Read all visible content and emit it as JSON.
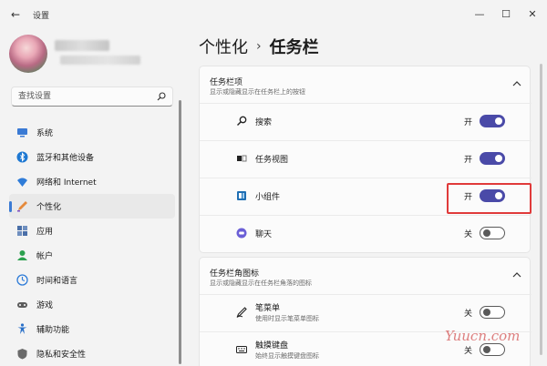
{
  "window": {
    "title": "设置",
    "back_glyph": "←",
    "min_glyph": "—",
    "max_glyph": "☐",
    "close_glyph": "✕"
  },
  "search": {
    "placeholder": "查找设置"
  },
  "sidebar": {
    "active_index": 3,
    "items": [
      {
        "label": "系统",
        "icon": "system-icon",
        "color": "#3a7ad4"
      },
      {
        "label": "蓝牙和其他设备",
        "icon": "bluetooth-icon",
        "color": "#1e78d2"
      },
      {
        "label": "网络和 Internet",
        "icon": "network-icon",
        "color": "#2f7cd8"
      },
      {
        "label": "个性化",
        "icon": "personalization-icon",
        "color": "#e58a3c"
      },
      {
        "label": "应用",
        "icon": "apps-icon",
        "color": "#4a6fa8"
      },
      {
        "label": "帐户",
        "icon": "accounts-icon",
        "color": "#2ba04e"
      },
      {
        "label": "时间和语言",
        "icon": "time-language-icon",
        "color": "#2f7cd8"
      },
      {
        "label": "游戏",
        "icon": "gaming-icon",
        "color": "#5c5c5c"
      },
      {
        "label": "辅助功能",
        "icon": "accessibility-icon",
        "color": "#2a70c8"
      },
      {
        "label": "隐私和安全性",
        "icon": "privacy-shield-icon",
        "color": "#6a6a6a"
      }
    ]
  },
  "breadcrumb": {
    "parent": "个性化",
    "separator": "›",
    "current": "任务栏"
  },
  "section_items": {
    "title": "任务栏项",
    "description": "显示或隐藏显示在任务栏上的按钮",
    "rows": [
      {
        "label": "搜索",
        "state_text": "开",
        "on": true,
        "icon": "search-icon"
      },
      {
        "label": "任务视图",
        "state_text": "开",
        "on": true,
        "icon": "task-view-icon"
      },
      {
        "label": "小组件",
        "state_text": "开",
        "on": true,
        "icon": "widgets-icon"
      },
      {
        "label": "聊天",
        "state_text": "关",
        "on": false,
        "icon": "chat-icon"
      }
    ]
  },
  "section_corner": {
    "title": "任务栏角图标",
    "description": "显示或隐藏显示在任务栏角落的图标",
    "rows": [
      {
        "label": "笔菜单",
        "description": "使用时显示笔菜单图标",
        "state_text": "关",
        "on": false,
        "icon": "pen-icon"
      },
      {
        "label": "触摸键盘",
        "description": "始终显示触摸键盘图标",
        "state_text": "关",
        "on": false,
        "icon": "keyboard-icon"
      }
    ]
  },
  "watermark": "Yuucn.com",
  "colors": {
    "accent": "#4a4aa8",
    "highlight": "#e03a3a"
  }
}
